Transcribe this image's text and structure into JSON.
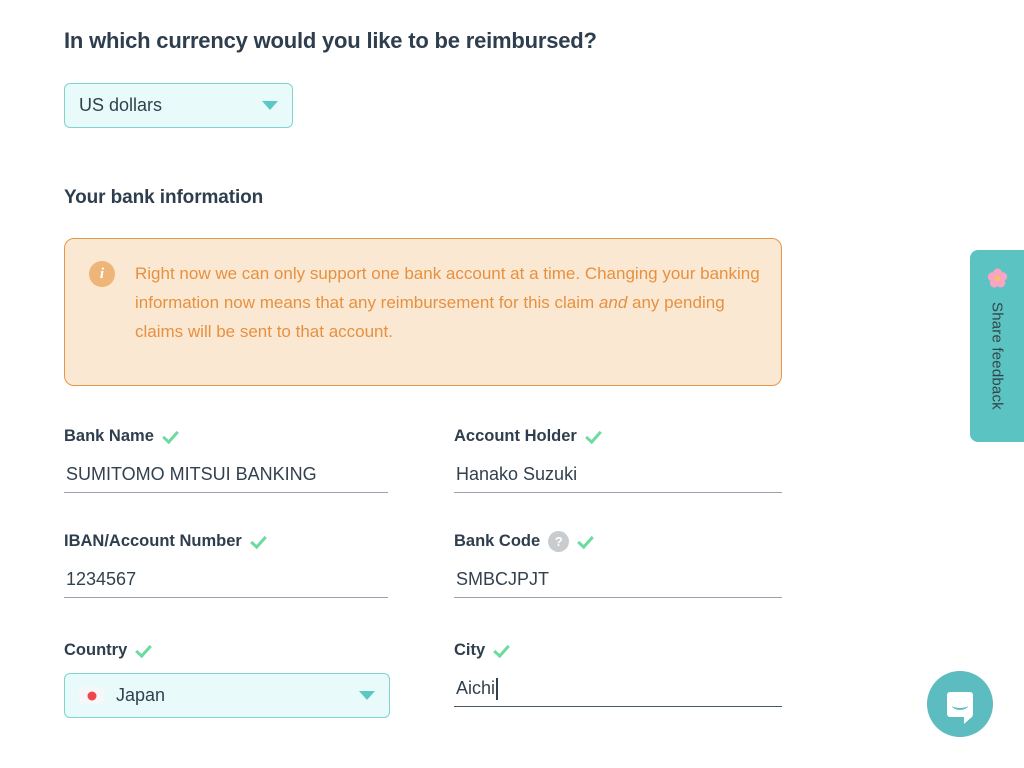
{
  "currency_section": {
    "question": "In which currency would you like to be reimbursed?",
    "select": {
      "value": "US dollars",
      "icon": "chevron-down-icon"
    }
  },
  "bank_section": {
    "heading": "Your bank information",
    "notice": {
      "icon": "info-icon",
      "text_part1": "Right now we can only support one bank account at a time. Changing your banking information now means that any reimbursement for this claim ",
      "emphasis": "and",
      "text_part2": " any pending claims will be sent to that account.",
      "background_color": "#fbe8d3",
      "border_color": "#e8974a",
      "text_color": "#e6913f"
    },
    "fields": {
      "bank_name": {
        "label": "Bank Name",
        "value": "SUMITOMO MITSUI BANKING",
        "valid": true
      },
      "account_holder": {
        "label": "Account Holder",
        "value": "Hanako Suzuki",
        "valid": true
      },
      "iban": {
        "label": "IBAN/Account Number",
        "value": "1234567",
        "valid": true
      },
      "bank_code": {
        "label": "Bank Code",
        "value": "SMBCJPJT",
        "help": "?",
        "valid": true
      },
      "country": {
        "label": "Country",
        "value": "Japan",
        "flag": "flag-japan-icon",
        "valid": true
      },
      "city": {
        "label": "City",
        "value": "Aichi",
        "valid": true,
        "focused": true
      }
    }
  },
  "feedback_tab": {
    "label": "Share feedback",
    "icon": "cherry-blossom-icon",
    "color": "#5cc3c3"
  },
  "chat_launcher": {
    "icon": "chat-bubble-icon",
    "color": "#5cbcc0"
  },
  "theme": {
    "heading_color": "#2f3e4e",
    "accent_teal": "#5bc8c4",
    "valid_green": "#6ddba0",
    "select_bg": "#e8fbfa"
  }
}
